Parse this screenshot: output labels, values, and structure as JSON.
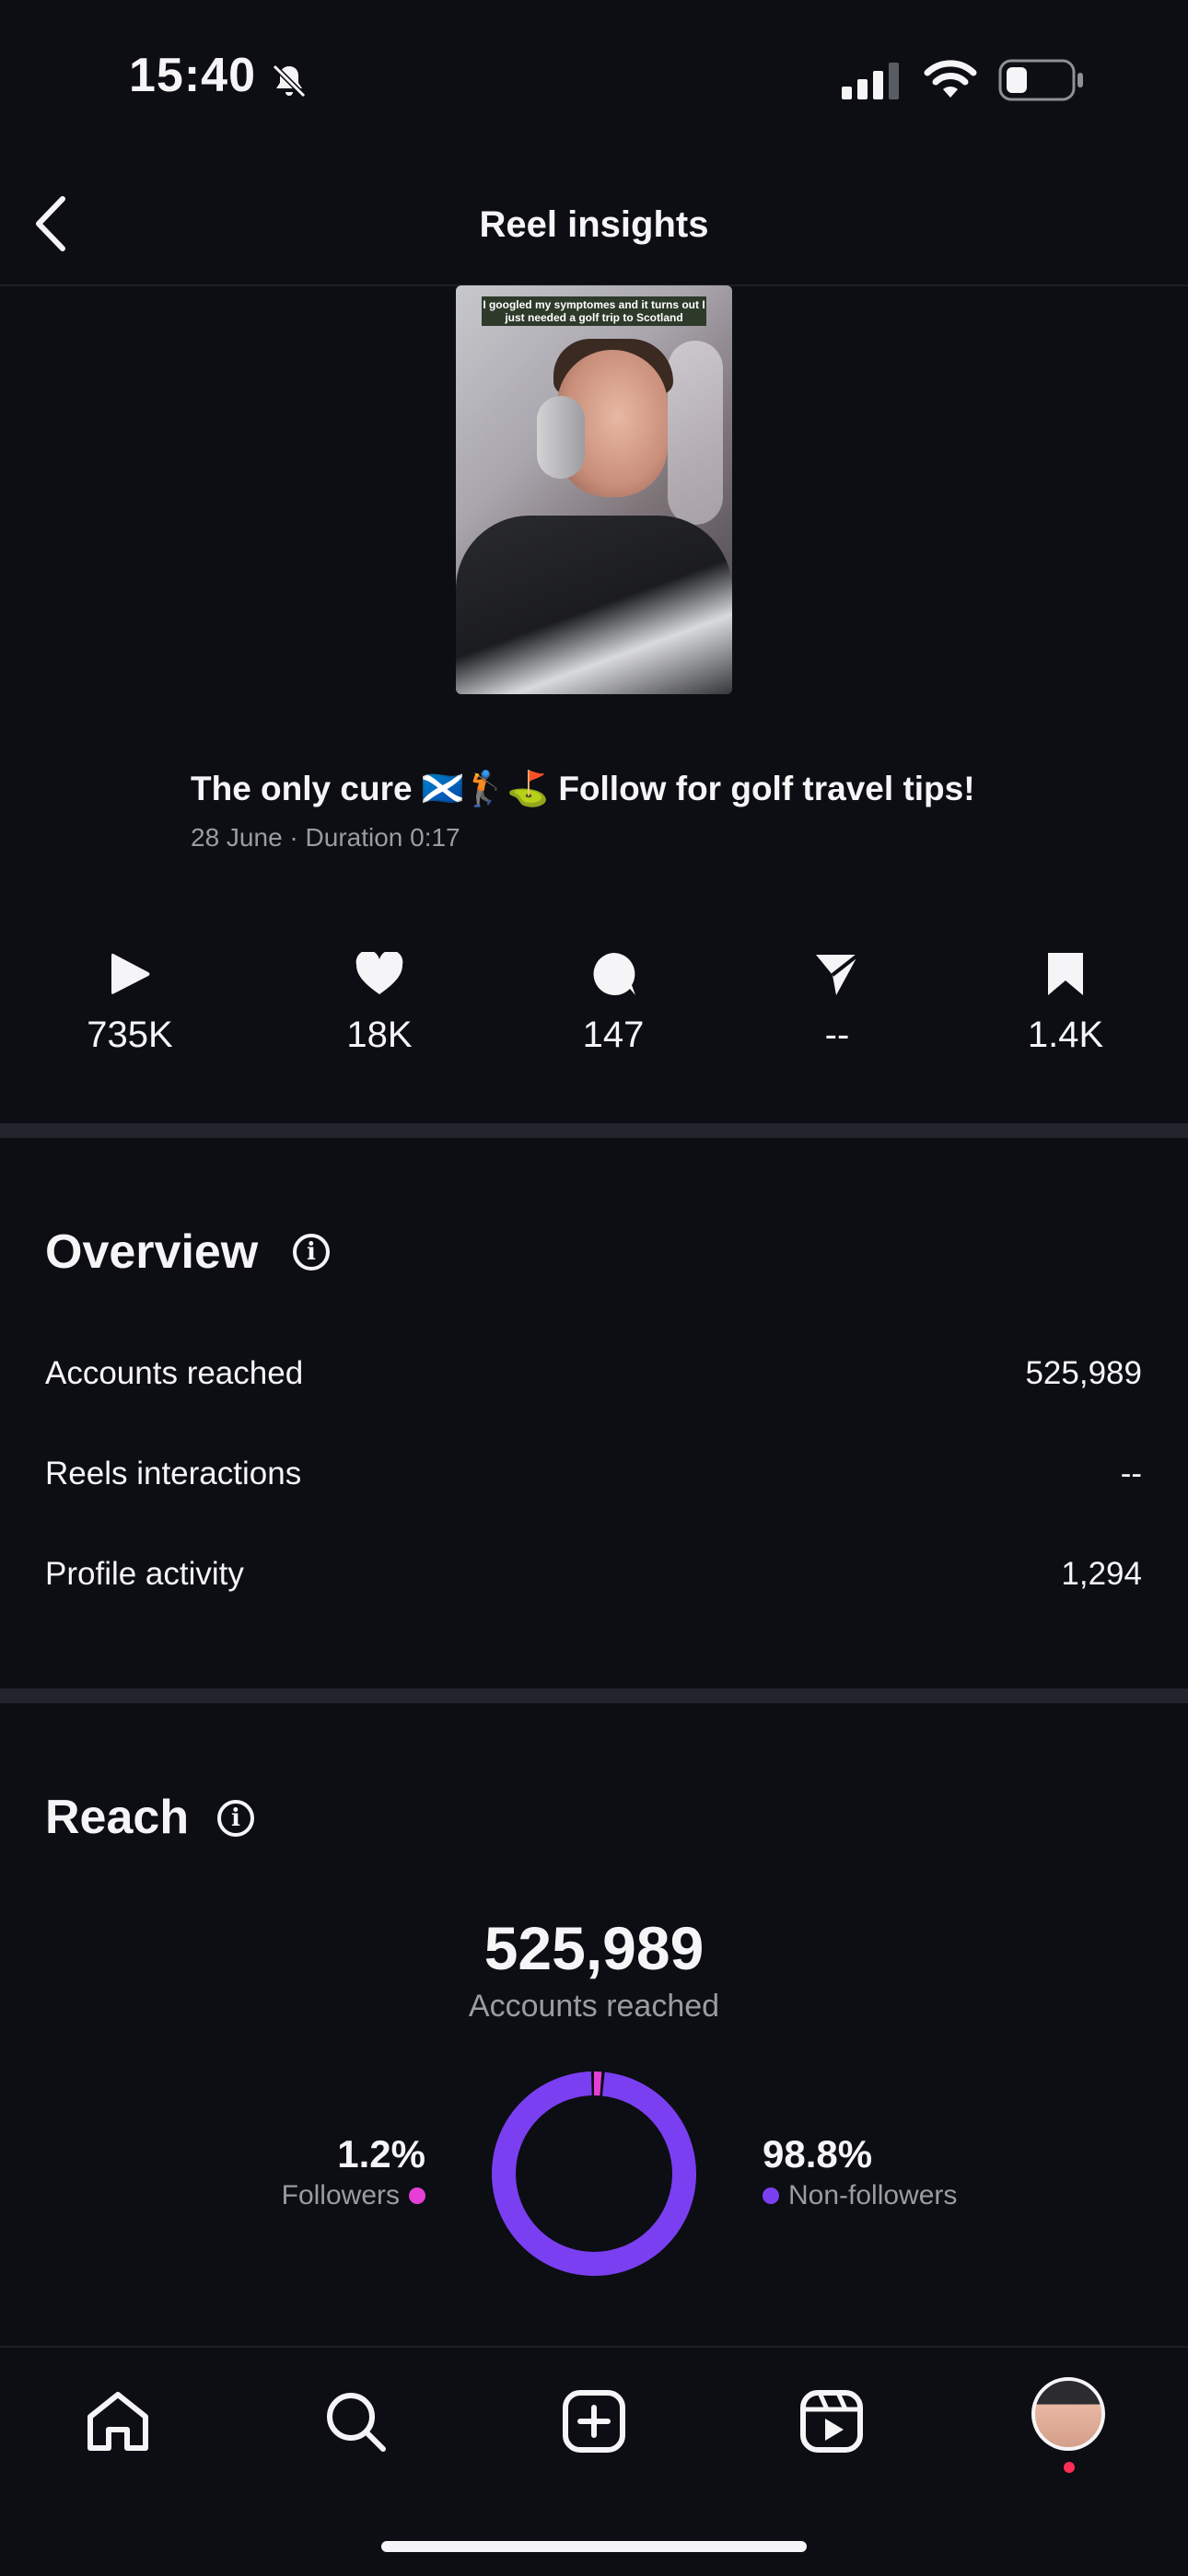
{
  "status_bar": {
    "time": "15:40"
  },
  "nav": {
    "title": "Reel insights"
  },
  "reel": {
    "thumbnail_caption": "I googled my symptomes and it turns out I just needed a golf trip to Scotland",
    "title": "The only cure 🏴󠁧󠁢󠁳󠁣󠁴󠁿🏌️⛳ Follow for golf travel tips!",
    "meta": "28 June · Duration 0:17"
  },
  "stats": [
    {
      "icon": "play-icon",
      "value": "735K"
    },
    {
      "icon": "heart-icon",
      "value": "18K"
    },
    {
      "icon": "comment-icon",
      "value": "147"
    },
    {
      "icon": "share-icon",
      "value": "--"
    },
    {
      "icon": "bookmark-icon",
      "value": "1.4K"
    }
  ],
  "overview": {
    "title": "Overview",
    "rows": [
      {
        "label": "Accounts reached",
        "value": "525,989"
      },
      {
        "label": "Reels interactions",
        "value": "--"
      },
      {
        "label": "Profile activity",
        "value": "1,294"
      }
    ]
  },
  "reach": {
    "title": "Reach",
    "total": "525,989",
    "total_label": "Accounts reached",
    "followers": {
      "pct": "1.2%",
      "label": "Followers",
      "color": "#e63fd6",
      "fraction": 0.012
    },
    "non_followers": {
      "pct": "98.8%",
      "label": "Non-followers",
      "color": "#7b3ff2",
      "fraction": 0.988
    }
  },
  "tabs": [
    "home-icon",
    "search-icon",
    "create-icon",
    "reels-icon",
    "profile-avatar"
  ]
}
